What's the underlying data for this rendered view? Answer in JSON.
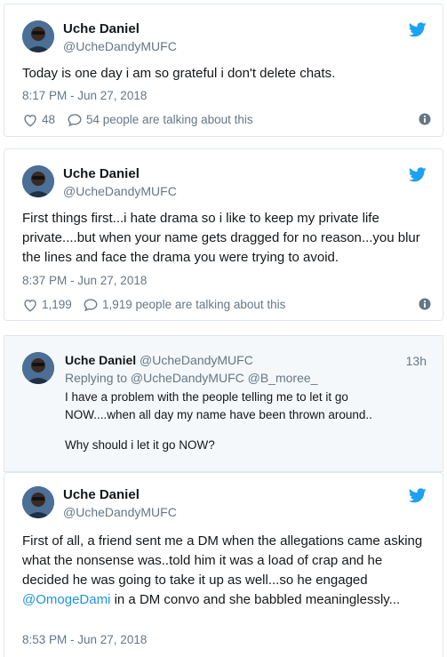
{
  "tweets": [
    {
      "name": "Uche Daniel",
      "handle": "@UcheDandyMUFC",
      "text": "Today is one day i am so grateful i don't delete chats.",
      "time": "8:17 PM - Jun 27, 2018",
      "likes": "48",
      "talking": "54 people are talking about this"
    },
    {
      "name": "Uche Daniel",
      "handle": "@UcheDandyMUFC",
      "text": "First things first...i hate drama so i like to keep my private life private....but when your name gets dragged for no reason...you blur the lines and face the drama you were trying to avoid.",
      "time": "8:37 PM - Jun 27, 2018",
      "likes": "1,199",
      "talking": "1,919 people are talking about this"
    },
    {
      "name": "Uche Daniel",
      "handle": "@UcheDandyMUFC",
      "text_before": "First of all, a friend sent me a DM when the allegations came asking what the nonsense was..told him it was a load of crap and he decided he was going to take it up as well...so he engaged ",
      "mention": "@OmogeDami",
      "text_after": " in a DM convo and she babbled meaninglessly...",
      "time": "8:53 PM - Jun 27, 2018"
    }
  ],
  "quoted": {
    "name": "Uche Daniel",
    "handle": "@UcheDandyMUFC",
    "age": "13h",
    "replying_to": "Replying to @UcheDandyMUFC @B_moree_",
    "line1": "I have a problem with the people telling me to let it go NOW....when all day my name have been thrown around..",
    "line2": "Why should i let it go NOW?"
  },
  "colors": {
    "border": "#e1e8ed",
    "secondary_text": "#657786",
    "link": "#1b95e0",
    "twitter_blue": "#1da1f2",
    "quoted_background": "#f5f8fa"
  },
  "icons": [
    "avatar",
    "twitter-bird-icon",
    "heart-icon",
    "reply-bubble-icon",
    "info-icon"
  ]
}
